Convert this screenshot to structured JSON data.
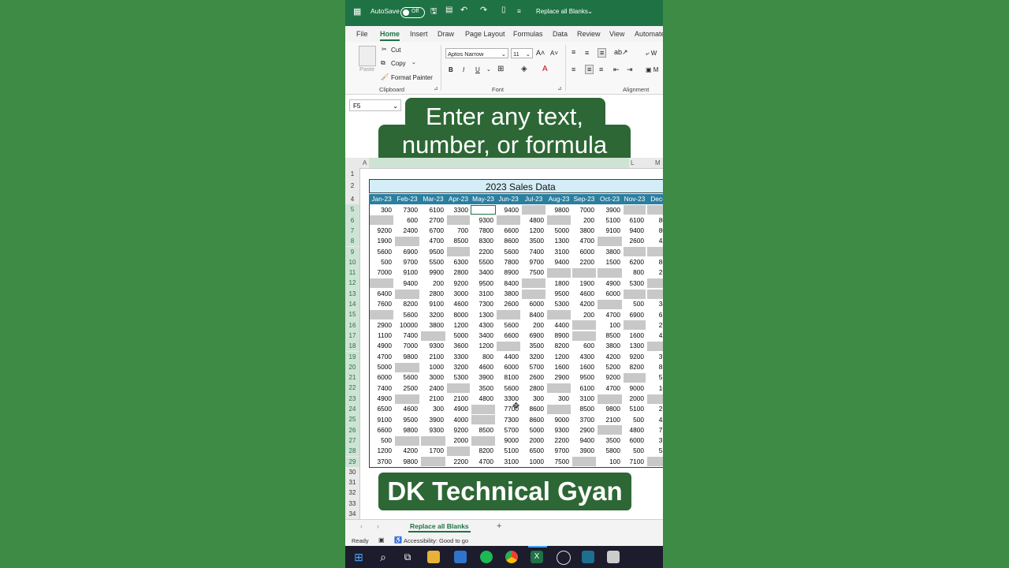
{
  "titlebar": {
    "autosave_label": "AutoSave",
    "autosave_state": "Off",
    "doc_title": "Replace all Blanks"
  },
  "tabs": [
    "File",
    "Home",
    "Insert",
    "Draw",
    "Page Layout",
    "Formulas",
    "Data",
    "Review",
    "View",
    "Automate"
  ],
  "active_tab": "Home",
  "ribbon": {
    "paste_label": "Paste",
    "cut_label": "Cut",
    "copy_label": "Copy",
    "format_painter_label": "Format Painter",
    "clipboard_group": "Clipboard",
    "font_name": "Aptos Narrow",
    "font_size": "11",
    "font_group": "Font",
    "alignment_group": "Alignment",
    "bold": "B",
    "italic": "I",
    "underline": "U",
    "wrap_partial": "W",
    "merge_partial": "M"
  },
  "formula_bar": {
    "name_box": "F5"
  },
  "callout_text": "Enter any text,\nnumber, or formula",
  "column_letters": [
    "A",
    "L",
    "M"
  ],
  "sheet": {
    "title": "2023 Sales Data",
    "months": [
      "Jan-23",
      "Feb-23",
      "Mar-23",
      "Apr-23",
      "May-23",
      "Jun-23",
      "Jul-23",
      "Aug-23",
      "Sep-23",
      "Oct-23",
      "Nov-23",
      "Dec-"
    ],
    "rows": [
      [
        "300",
        "7300",
        "6100",
        "3300",
        "",
        "9400",
        "",
        "9800",
        "7000",
        "3900",
        "",
        ""
      ],
      [
        "",
        "600",
        "2700",
        "",
        "9300",
        "",
        "4800",
        "",
        "200",
        "5100",
        "6100",
        "80"
      ],
      [
        "9200",
        "2400",
        "6700",
        "700",
        "7800",
        "6600",
        "1200",
        "5000",
        "3800",
        "9100",
        "9400",
        "80"
      ],
      [
        "1900",
        "",
        "4700",
        "8500",
        "8300",
        "8600",
        "3500",
        "1300",
        "4700",
        "",
        "2600",
        "42"
      ],
      [
        "5600",
        "6900",
        "9500",
        "",
        "2200",
        "5600",
        "7400",
        "3100",
        "6000",
        "3800",
        "",
        ""
      ],
      [
        "500",
        "9700",
        "5500",
        "6300",
        "5500",
        "7800",
        "9700",
        "9400",
        "2200",
        "1500",
        "6200",
        "86"
      ],
      [
        "7000",
        "9100",
        "9900",
        "2800",
        "3400",
        "8900",
        "7500",
        "",
        "",
        "",
        "800",
        "25"
      ],
      [
        "",
        "9400",
        "200",
        "9200",
        "9500",
        "8400",
        "",
        "1800",
        "1900",
        "4900",
        "5300",
        ""
      ],
      [
        "6400",
        "",
        "2800",
        "3000",
        "3100",
        "3800",
        "",
        "9500",
        "4600",
        "6000",
        "",
        ""
      ],
      [
        "7600",
        "8200",
        "9100",
        "4600",
        "7300",
        "2600",
        "6000",
        "5300",
        "4200",
        "",
        "500",
        "34"
      ],
      [
        "",
        "5600",
        "3200",
        "8000",
        "1300",
        "",
        "8400",
        "",
        "200",
        "4700",
        "6900",
        "61"
      ],
      [
        "2900",
        "10000",
        "3800",
        "1200",
        "4300",
        "5600",
        "200",
        "4400",
        "",
        "100",
        "",
        "27"
      ],
      [
        "1100",
        "7400",
        "",
        "5000",
        "3400",
        "6600",
        "6900",
        "8900",
        "",
        "8500",
        "1600",
        "42"
      ],
      [
        "4900",
        "7000",
        "9300",
        "3600",
        "1200",
        "",
        "3500",
        "8200",
        "600",
        "3800",
        "1300",
        ""
      ],
      [
        "4700",
        "9800",
        "2100",
        "3300",
        "800",
        "4400",
        "3200",
        "1200",
        "4300",
        "4200",
        "9200",
        "31"
      ],
      [
        "5000",
        "",
        "1000",
        "3200",
        "4600",
        "6000",
        "5700",
        "1600",
        "1600",
        "5200",
        "8200",
        "83"
      ],
      [
        "6000",
        "5600",
        "3000",
        "5300",
        "3900",
        "8100",
        "2600",
        "2900",
        "9500",
        "9200",
        "",
        "51"
      ],
      [
        "7400",
        "2500",
        "2400",
        "",
        "3500",
        "5600",
        "2800",
        "",
        "6100",
        "4700",
        "9000",
        "16"
      ],
      [
        "4900",
        "",
        "2100",
        "2100",
        "4800",
        "3300",
        "300",
        "300",
        "3100",
        "",
        "2000",
        ""
      ],
      [
        "6500",
        "4600",
        "300",
        "4900",
        "",
        "7700",
        "8600",
        "",
        "8500",
        "9800",
        "5100",
        "25"
      ],
      [
        "9100",
        "9500",
        "3900",
        "4000",
        "",
        "7300",
        "8600",
        "9000",
        "3700",
        "2100",
        "500",
        "43"
      ],
      [
        "6600",
        "9800",
        "9300",
        "9200",
        "8500",
        "5700",
        "5000",
        "9300",
        "2900",
        "",
        "4800",
        "71"
      ],
      [
        "500",
        "",
        "",
        "2000",
        "",
        "9000",
        "2000",
        "2200",
        "9400",
        "3500",
        "6000",
        "31"
      ],
      [
        "1200",
        "4200",
        "1700",
        "",
        "8200",
        "5100",
        "6500",
        "9700",
        "3900",
        "5800",
        "500",
        "53"
      ],
      [
        "3700",
        "9800",
        "",
        "2200",
        "4700",
        "3100",
        "1000",
        "7500",
        "",
        "100",
        "7100",
        ""
      ]
    ]
  },
  "row_numbers": [
    "1",
    "2",
    "4",
    "5",
    "6",
    "7",
    "8",
    "9",
    "10",
    "11",
    "12",
    "13",
    "14",
    "15",
    "16",
    "17",
    "18",
    "19",
    "20",
    "21",
    "22",
    "23",
    "24",
    "25",
    "26",
    "27",
    "28",
    "29",
    "30",
    "31",
    "32",
    "33",
    "34"
  ],
  "banner_text": "DK Technical Gyan",
  "sheet_tab": "Replace all Blanks",
  "status": {
    "ready": "Ready",
    "accessibility": "Accessibility: Good to go"
  },
  "colors": {
    "excel_green": "#1f7244",
    "header_blue": "#2a7fa0",
    "title_fill": "#d4eef7",
    "blank_gray": "#c8c8c8",
    "background": "#3d8b45"
  }
}
